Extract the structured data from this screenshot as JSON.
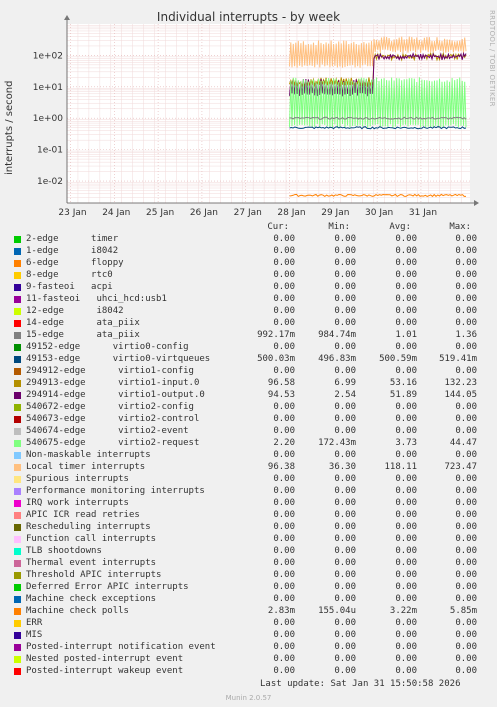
{
  "title": "Individual interrupts - by week",
  "side_tag": "RRDTOOL / TOBI OETIKER",
  "legend_headers": {
    "cur": "Cur:",
    "min": "Min:",
    "avg": "Avg:",
    "max": "Max:"
  },
  "legend": [
    {
      "label": "2-edge      timer",
      "color": "#00cc00",
      "cur": "0.00",
      "min": "0.00",
      "avg": "0.00",
      "max": "0.00"
    },
    {
      "label": "1-edge      i8042",
      "color": "#0066b3",
      "cur": "0.00",
      "min": "0.00",
      "avg": "0.00",
      "max": "0.00"
    },
    {
      "label": "6-edge      floppy",
      "color": "#ff8000",
      "cur": "0.00",
      "min": "0.00",
      "avg": "0.00",
      "max": "0.00"
    },
    {
      "label": "8-edge      rtc0",
      "color": "#ffcc00",
      "cur": "0.00",
      "min": "0.00",
      "avg": "0.00",
      "max": "0.00"
    },
    {
      "label": "9-fasteoi   acpi",
      "color": "#330099",
      "cur": "0.00",
      "min": "0.00",
      "avg": "0.00",
      "max": "0.00"
    },
    {
      "label": "11-fasteoi   uhci_hcd:usb1",
      "color": "#990099",
      "cur": "0.00",
      "min": "0.00",
      "avg": "0.00",
      "max": "0.00"
    },
    {
      "label": "12-edge      i8042",
      "color": "#ccff00",
      "cur": "0.00",
      "min": "0.00",
      "avg": "0.00",
      "max": "0.00"
    },
    {
      "label": "14-edge      ata_piix",
      "color": "#ff0000",
      "cur": "0.00",
      "min": "0.00",
      "avg": "0.00",
      "max": "0.00"
    },
    {
      "label": "15-edge      ata_piix",
      "color": "#808080",
      "cur": "992.17m",
      "min": "984.74m",
      "avg": "1.01",
      "max": "1.36"
    },
    {
      "label": "49152-edge      virtio0-config",
      "color": "#008f00",
      "cur": "0.00",
      "min": "0.00",
      "avg": "0.00",
      "max": "0.00"
    },
    {
      "label": "49153-edge      virtio0-virtqueues",
      "color": "#00487d",
      "cur": "500.03m",
      "min": "496.83m",
      "avg": "500.59m",
      "max": "519.41m"
    },
    {
      "label": "294912-edge      virtio1-config",
      "color": "#b35a00",
      "cur": "0.00",
      "min": "0.00",
      "avg": "0.00",
      "max": "0.00"
    },
    {
      "label": "294913-edge      virtio1-input.0",
      "color": "#b38f00",
      "cur": "96.58",
      "min": "6.99",
      "avg": "53.16",
      "max": "132.23"
    },
    {
      "label": "294914-edge      virtio1-output.0",
      "color": "#6b006b",
      "cur": "94.53",
      "min": "2.54",
      "avg": "51.89",
      "max": "144.05"
    },
    {
      "label": "540672-edge      virtio2-config",
      "color": "#8fb300",
      "cur": "0.00",
      "min": "0.00",
      "avg": "0.00",
      "max": "0.00"
    },
    {
      "label": "540673-edge      virtio2-control",
      "color": "#b30000",
      "cur": "0.00",
      "min": "0.00",
      "avg": "0.00",
      "max": "0.00"
    },
    {
      "label": "540674-edge      virtio2-event",
      "color": "#bebebe",
      "cur": "0.00",
      "min": "0.00",
      "avg": "0.00",
      "max": "0.00"
    },
    {
      "label": "540675-edge      virtio2-request",
      "color": "#80ff80",
      "cur": "2.20",
      "min": "172.43m",
      "avg": "3.73",
      "max": "44.47"
    },
    {
      "label": "Non-maskable interrupts",
      "color": "#80c9ff",
      "cur": "0.00",
      "min": "0.00",
      "avg": "0.00",
      "max": "0.00"
    },
    {
      "label": "Local timer interrupts",
      "color": "#ffc080",
      "cur": "96.38",
      "min": "36.30",
      "avg": "118.11",
      "max": "723.47"
    },
    {
      "label": "Spurious interrupts",
      "color": "#ffe680",
      "cur": "0.00",
      "min": "0.00",
      "avg": "0.00",
      "max": "0.00"
    },
    {
      "label": "Performance monitoring interrupts",
      "color": "#aa80ff",
      "cur": "0.00",
      "min": "0.00",
      "avg": "0.00",
      "max": "0.00"
    },
    {
      "label": "IRQ work interrupts",
      "color": "#ee00cc",
      "cur": "0.00",
      "min": "0.00",
      "avg": "0.00",
      "max": "0.00"
    },
    {
      "label": "APIC ICR read retries",
      "color": "#ff8080",
      "cur": "0.00",
      "min": "0.00",
      "avg": "0.00",
      "max": "0.00"
    },
    {
      "label": "Rescheduling interrupts",
      "color": "#666600",
      "cur": "0.00",
      "min": "0.00",
      "avg": "0.00",
      "max": "0.00"
    },
    {
      "label": "Function call interrupts",
      "color": "#ffbfff",
      "cur": "0.00",
      "min": "0.00",
      "avg": "0.00",
      "max": "0.00"
    },
    {
      "label": "TLB shootdowns",
      "color": "#00ffcc",
      "cur": "0.00",
      "min": "0.00",
      "avg": "0.00",
      "max": "0.00"
    },
    {
      "label": "Thermal event interrupts",
      "color": "#cc6699",
      "cur": "0.00",
      "min": "0.00",
      "avg": "0.00",
      "max": "0.00"
    },
    {
      "label": "Threshold APIC interrupts",
      "color": "#999900",
      "cur": "0.00",
      "min": "0.00",
      "avg": "0.00",
      "max": "0.00"
    },
    {
      "label": "Deferred Error APIC interrupts",
      "color": "#00cc00",
      "cur": "0.00",
      "min": "0.00",
      "avg": "0.00",
      "max": "0.00"
    },
    {
      "label": "Machine check exceptions",
      "color": "#0066b3",
      "cur": "0.00",
      "min": "0.00",
      "avg": "0.00",
      "max": "0.00"
    },
    {
      "label": "Machine check polls",
      "color": "#ff8000",
      "cur": "2.83m",
      "min": "155.04u",
      "avg": "3.22m",
      "max": "5.85m"
    },
    {
      "label": "ERR",
      "color": "#ffcc00",
      "cur": "0.00",
      "min": "0.00",
      "avg": "0.00",
      "max": "0.00"
    },
    {
      "label": "MIS",
      "color": "#330099",
      "cur": "0.00",
      "min": "0.00",
      "avg": "0.00",
      "max": "0.00"
    },
    {
      "label": "Posted-interrupt notification event",
      "color": "#990099",
      "cur": "0.00",
      "min": "0.00",
      "avg": "0.00",
      "max": "0.00"
    },
    {
      "label": "Nested posted-interrupt event",
      "color": "#ccff00",
      "cur": "0.00",
      "min": "0.00",
      "avg": "0.00",
      "max": "0.00"
    },
    {
      "label": "Posted-interrupt wakeup event",
      "color": "#ff0000",
      "cur": "0.00",
      "min": "0.00",
      "avg": "0.00",
      "max": "0.00"
    }
  ],
  "last_update": "Last update: Sat Jan 31 15:50:58 2026",
  "munin_version": "Munin 2.0.57",
  "chart_data": {
    "type": "line",
    "title": "Individual interrupts - by week",
    "ylabel": "interrupts / second",
    "yscale": "log",
    "ylim": [
      0.002,
      1000
    ],
    "y_ticks": [
      "1e-02",
      "1e-01",
      "1e+00",
      "1e+01",
      "1e+02"
    ],
    "x_ticks": [
      "23 Jan",
      "24 Jan",
      "25 Jan",
      "26 Jan",
      "27 Jan",
      "28 Jan",
      "29 Jan",
      "30 Jan",
      "31 Jan"
    ],
    "data_start": "28 Jan",
    "series": [
      {
        "name": "Local timer interrupts",
        "color": "#ffc080",
        "before": [
          40,
          300
        ],
        "after": [
          120,
          400
        ],
        "step_at": "29 Jan 22:00"
      },
      {
        "name": "294913-edge      virtio1-input.0",
        "color": "#b38f00",
        "before": [
          10,
          20
        ],
        "after": [
          90,
          100
        ],
        "step_at": "29 Jan 22:00"
      },
      {
        "name": "294914-edge      virtio1-output.0",
        "color": "#6b006b",
        "before": [
          5,
          18
        ],
        "after": [
          90,
          100
        ],
        "step_at": "29 Jan 22:00"
      },
      {
        "name": "540675-edge      virtio2-request",
        "color": "#80ff80",
        "range": [
          0.5,
          20
        ]
      },
      {
        "name": "15-edge      ata_piix",
        "color": "#808080",
        "level": 1.0
      },
      {
        "name": "49153-edge      virtio0-virtqueues",
        "color": "#00487d",
        "level": 0.5
      },
      {
        "name": "Machine check polls",
        "color": "#ff8000",
        "level": 0.0035
      }
    ],
    "grid": true
  }
}
